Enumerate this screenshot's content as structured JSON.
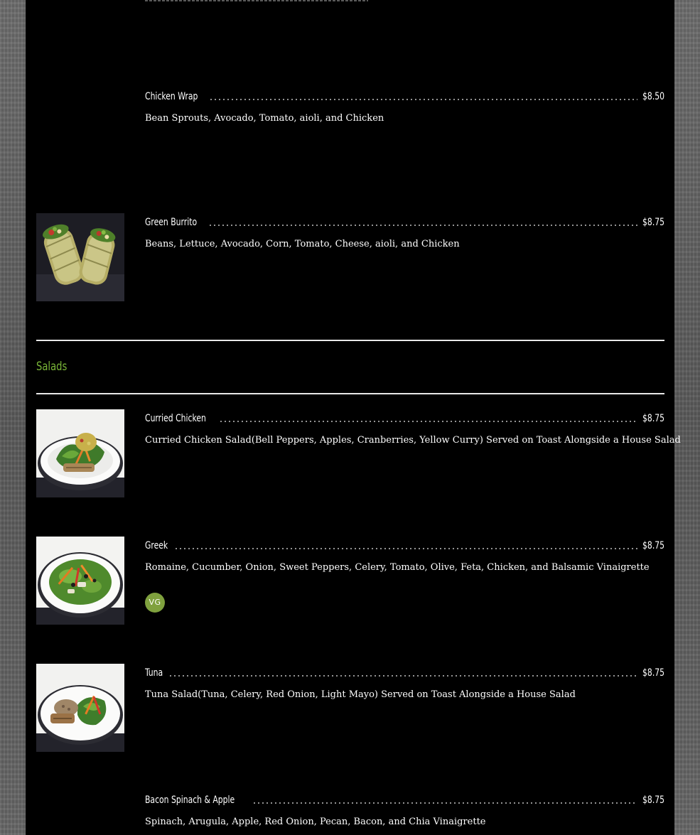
{
  "sections": {
    "salads_title": "Salads"
  },
  "items": {
    "chicken_wrap": {
      "name": "Chicken Wrap",
      "price": "$8.50",
      "description": "Bean Sprouts, Avocado, Tomato, aioli, and Chicken"
    },
    "green_burrito": {
      "name": "Green Burrito",
      "price": "$8.75",
      "description": "Beans, Lettuce, Avocado, Corn, Tomato, Cheese, aioli, and Chicken"
    },
    "curried_chicken": {
      "name": "Curried Chicken",
      "price": "$8.75",
      "description": "Curried Chicken Salad(Bell Peppers, Apples, Cranberries, Yellow Curry) Served on Toast Alongside a House Salad"
    },
    "greek": {
      "name": "Greek",
      "price": "$8.75",
      "description": "Romaine, Cucumber, Onion, Sweet Peppers, Celery, Tomato, Olive, Feta, Chicken, and Balsamic Vinaigrette",
      "badge": "VG"
    },
    "tuna": {
      "name": "Tuna",
      "price": "$8.75",
      "description": "Tuna Salad(Tuna, Celery, Red Onion, Light Mayo) Served on Toast Alongside a House Salad"
    },
    "bacon_spinach_apple": {
      "name": "Bacon Spinach & Apple",
      "price": "$8.75",
      "description": "Spinach, Arugula, Apple, Red Onion, Pecan, Bacon, and Chia Vinaigrette"
    }
  },
  "colors": {
    "panel_background": "#000000",
    "section_title": "#7ab638",
    "badge": "#7fa13e",
    "text": "#ffffff"
  }
}
